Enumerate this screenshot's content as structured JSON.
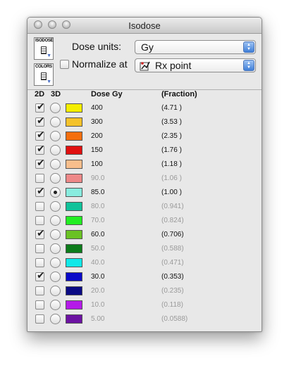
{
  "window": {
    "title": "Isodose"
  },
  "toolbar": {
    "isodose_menu_label": "ISODOSE",
    "colors_menu_label": "COLORS",
    "dose_units_label": "Dose units:",
    "dose_units_value": "Gy",
    "normalize_label": "Normalize at",
    "normalize_checked": false,
    "normalize_value": "Rx point"
  },
  "table": {
    "headers": {
      "col_2d": "2D",
      "col_3d": "3D",
      "col_dose": "Dose Gy",
      "col_fraction": "(Fraction)"
    },
    "rows": [
      {
        "dose": "400",
        "fraction": "(4.71 )",
        "color": "#f4ee00",
        "show2d": true,
        "selected3d": false,
        "active": true
      },
      {
        "dose": "300",
        "fraction": "(3.53 )",
        "color": "#f4c22a",
        "show2d": true,
        "selected3d": false,
        "active": true
      },
      {
        "dose": "200",
        "fraction": "(2.35 )",
        "color": "#f46e0e",
        "show2d": true,
        "selected3d": false,
        "active": true
      },
      {
        "dose": "150",
        "fraction": "(1.76 )",
        "color": "#e01010",
        "show2d": true,
        "selected3d": false,
        "active": true
      },
      {
        "dose": "100",
        "fraction": "(1.18 )",
        "color": "#f8be8c",
        "show2d": true,
        "selected3d": false,
        "active": true
      },
      {
        "dose": "90.0",
        "fraction": "(1.06 )",
        "color": "#ee8888",
        "show2d": false,
        "selected3d": false,
        "active": false
      },
      {
        "dose": "85.0",
        "fraction": "(1.00 )",
        "color": "#88ecdf",
        "show2d": true,
        "selected3d": true,
        "active": true
      },
      {
        "dose": "80.0",
        "fraction": "(0.941)",
        "color": "#10c29a",
        "show2d": false,
        "selected3d": false,
        "active": false
      },
      {
        "dose": "70.0",
        "fraction": "(0.824)",
        "color": "#22ee22",
        "show2d": false,
        "selected3d": false,
        "active": false
      },
      {
        "dose": "60.0",
        "fraction": "(0.706)",
        "color": "#6ac224",
        "show2d": true,
        "selected3d": false,
        "active": true
      },
      {
        "dose": "50.0",
        "fraction": "(0.588)",
        "color": "#0c7c1a",
        "show2d": false,
        "selected3d": false,
        "active": false
      },
      {
        "dose": "40.0",
        "fraction": "(0.471)",
        "color": "#10e8e8",
        "show2d": false,
        "selected3d": false,
        "active": false
      },
      {
        "dose": "30.0",
        "fraction": "(0.353)",
        "color": "#0a0ac8",
        "show2d": true,
        "selected3d": false,
        "active": true
      },
      {
        "dose": "20.0",
        "fraction": "(0.235)",
        "color": "#0a0a84",
        "show2d": false,
        "selected3d": false,
        "active": false
      },
      {
        "dose": "10.0",
        "fraction": "(0.118)",
        "color": "#b41ae8",
        "show2d": false,
        "selected3d": false,
        "active": false
      },
      {
        "dose": "5.00",
        "fraction": "(0.0588)",
        "color": "#6c12a2",
        "show2d": false,
        "selected3d": false,
        "active": false
      }
    ]
  }
}
